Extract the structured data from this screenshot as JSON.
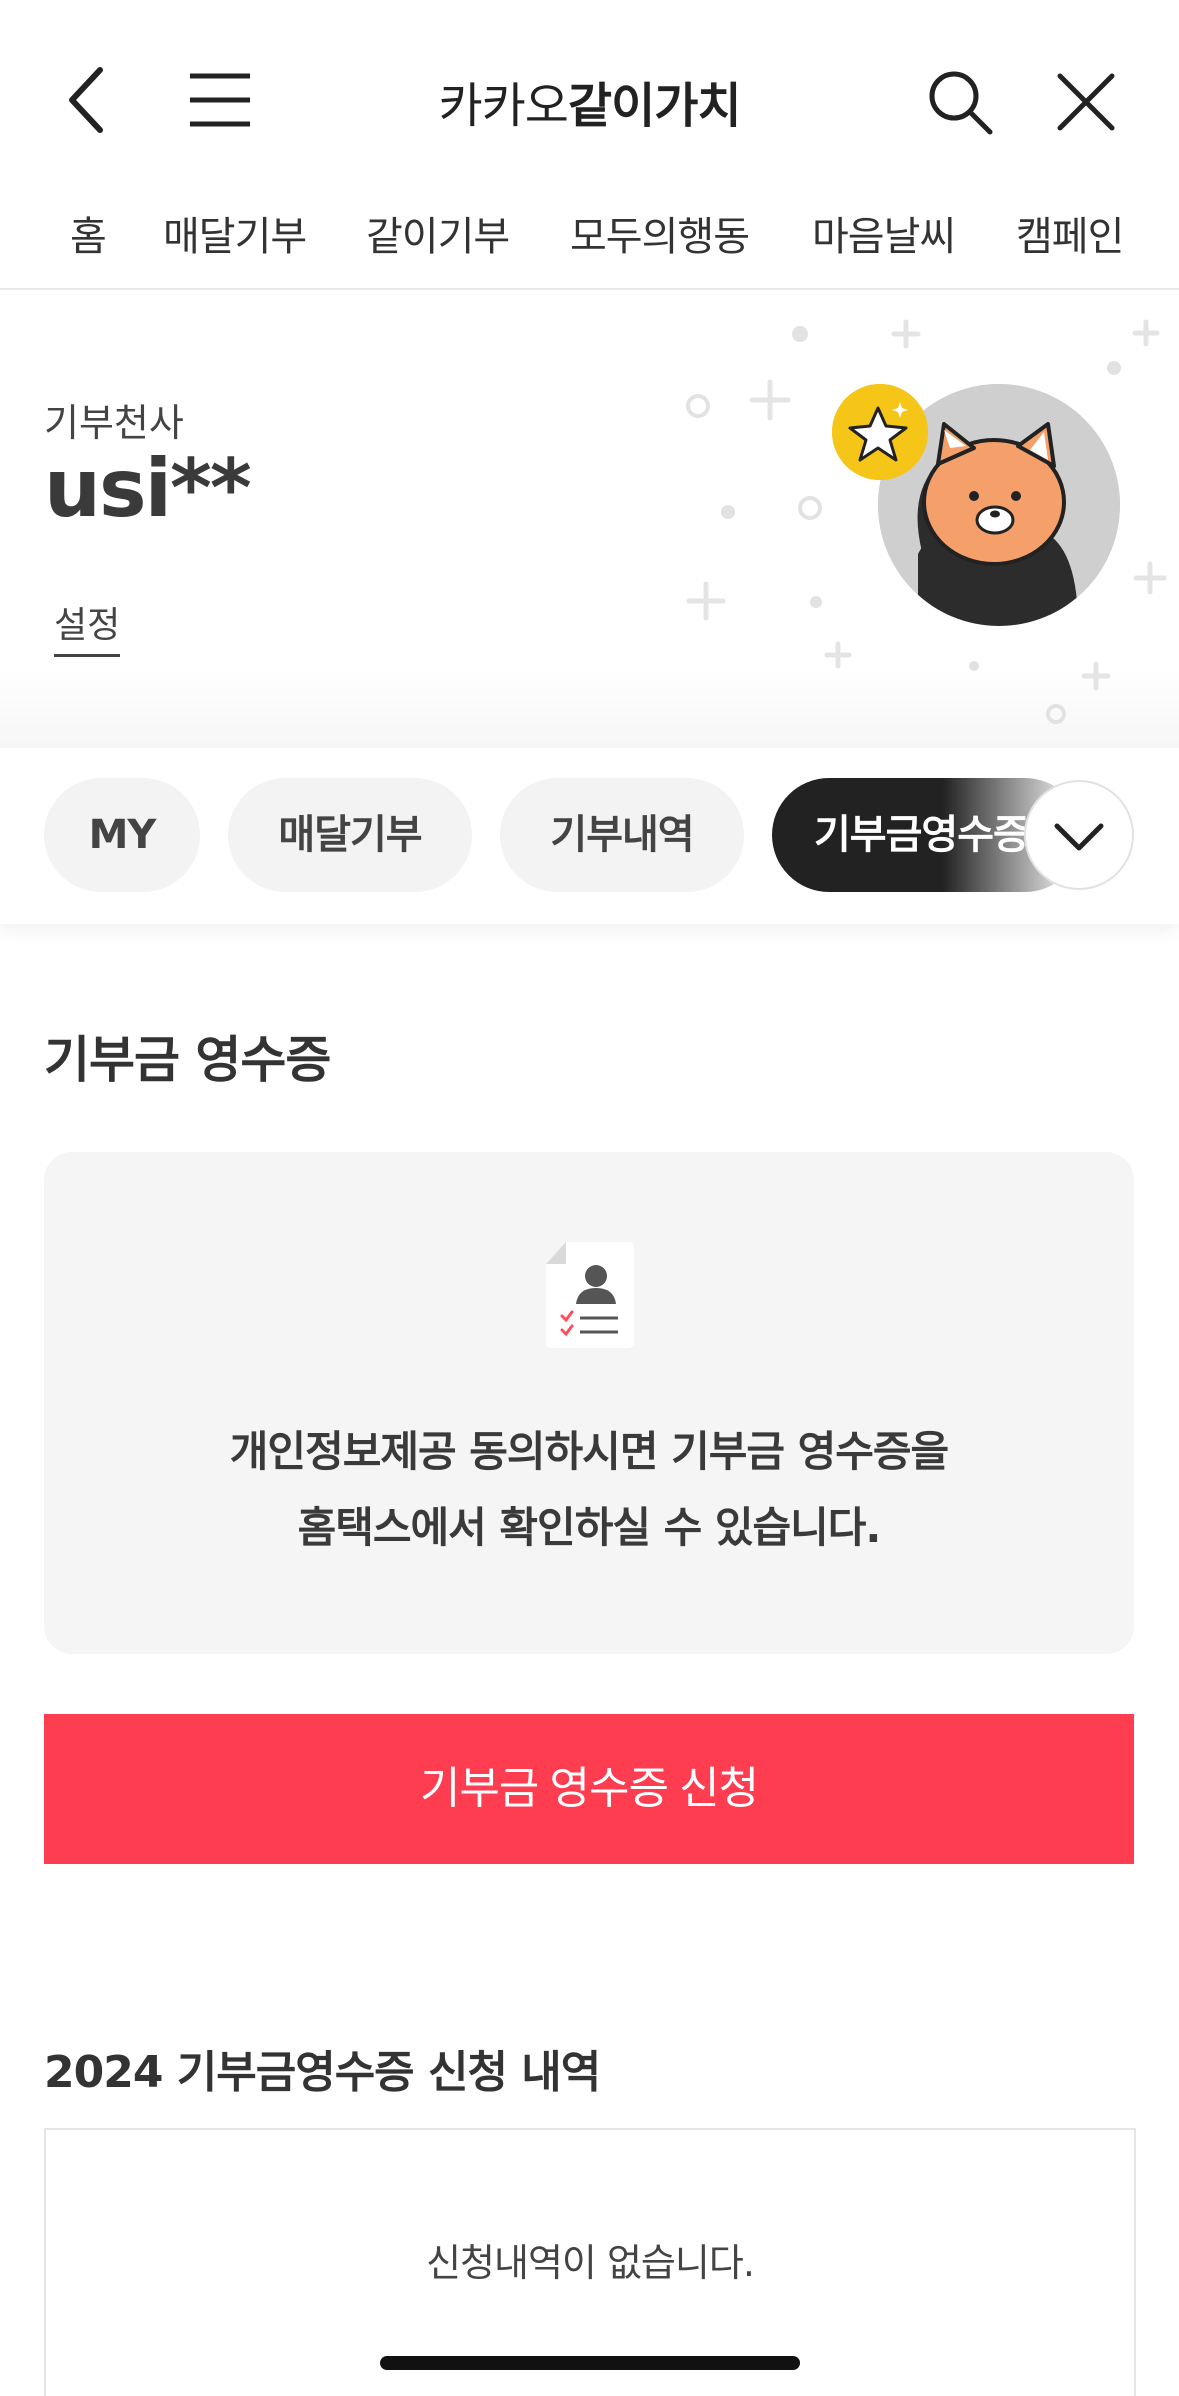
{
  "header": {
    "brand_light": "카카오",
    "brand_bold": "같이가치"
  },
  "category_nav": {
    "items": [
      "홈",
      "매달기부",
      "같이기부",
      "모두의행동",
      "마음날씨",
      "캠페인"
    ]
  },
  "profile": {
    "rank": "기부천사",
    "username": "usi**",
    "settings": "설정"
  },
  "tabs": {
    "items": [
      "MY",
      "매달기부",
      "기부내역",
      "기부금영수증"
    ],
    "active_index": 3
  },
  "receipt": {
    "title": "기부금 영수증",
    "info_line1": "개인정보제공 동의하시면 기부금 영수증을",
    "info_line2": "홈택스에서 확인하실 수 있습니다.",
    "apply_button": "기부금 영수증 신청"
  },
  "history": {
    "title": "2024 기부금영수증 신청 내역",
    "empty_text": "신청내역이 없습니다."
  },
  "colors": {
    "accent": "#ff3d50",
    "active_tab": "#222222",
    "card_bg": "#f5f5f5",
    "badge": "#f5c518"
  }
}
